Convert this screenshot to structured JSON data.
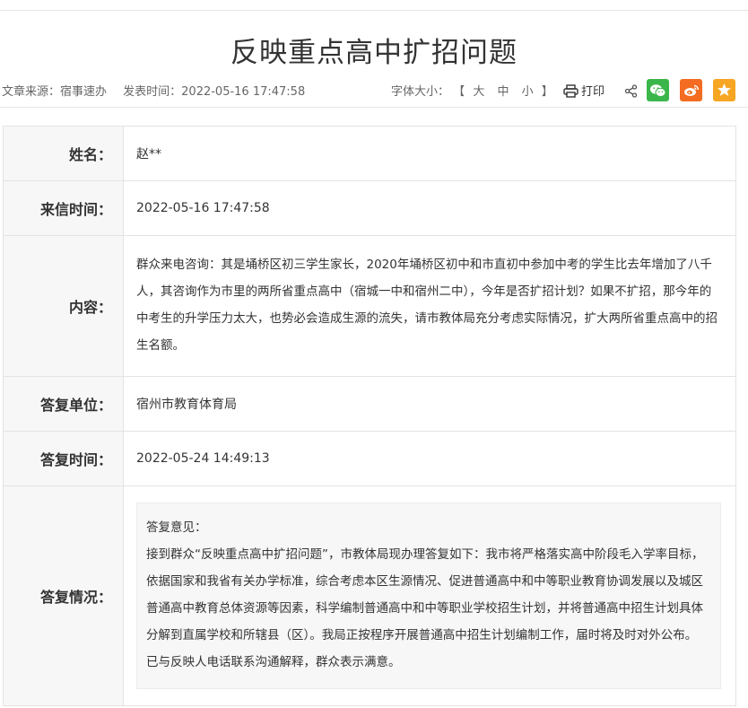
{
  "article": {
    "title": "反映重点高中扩招问题",
    "source": "文章来源：宿事速办",
    "publish_time": "发表时间：2022-05-16 17:47:58"
  },
  "toolbar": {
    "font_size_label": "字体大小：",
    "bracket_open": "【",
    "bracket_close": "】",
    "size_large": "大",
    "size_medium": "中",
    "size_small": "小",
    "print_label": "打印"
  },
  "share": {
    "icons": [
      "share-icon",
      "wechat-icon",
      "weibo-icon",
      "favorite-star-icon"
    ],
    "colors": {
      "wechat": "#3bb64a",
      "weibo": "#f36c21",
      "favorite": "#f6a623"
    }
  },
  "details": {
    "name_label": "姓名：",
    "name_value": "赵**",
    "letter_time_label": "来信时间：",
    "letter_time_value": "2022-05-16 17:47:58",
    "content_label": "内容：",
    "content_value": "群众来电咨询：其是埇桥区初三学生家长，2020年埇桥区初中和市直初中参加中考的学生比去年增加了八千人，其咨询作为市里的两所省重点高中（宿城一中和宿州二中），今年是否扩招计划？如果不扩招，那今年的中考生的升学压力太大，也势必会造成生源的流失，请市教体局充分考虑实际情况，扩大两所省重点高中的招生名额。",
    "reply_unit_label": "答复单位：",
    "reply_unit_value": "宿州市教育体育局",
    "reply_time_label": "答复时间：",
    "reply_time_value": "2022-05-24 14:49:13",
    "reply_status_label": "答复情况：",
    "reply_heading": "答复意见：",
    "reply_body": "接到群众“反映重点高中扩招问题”，市教体局现办理答复如下：我市将严格落实高中阶段毛入学率目标，依据国家和我省有关办学标准，综合考虑本区生源情况、促进普通高中和中等职业教育协调发展以及城区普通高中教育总体资源等因素，科学编制普通高中和中等职业学校招生计划，并将普通高中招生计划具体分解到直属学校和所辖县（区）。我局正按程序开展普通高中招生计划编制工作，届时将及时对外公布。已与反映人电话联系沟通解释，群众表示满意。"
  }
}
